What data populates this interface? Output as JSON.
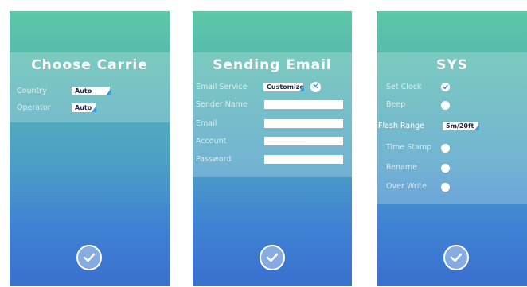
{
  "screen1": {
    "title": "Choose Carrie",
    "rows": [
      {
        "label": "Country",
        "value": "Auto"
      },
      {
        "label": "Operator",
        "value": "Auto"
      }
    ]
  },
  "screen2": {
    "title": "Sending Email",
    "email_service": {
      "label": "Email Service",
      "value": "Customize",
      "icon": "close-icon"
    },
    "fields": [
      {
        "label": "Sender Name",
        "value": ""
      },
      {
        "label": "Email",
        "value": ""
      },
      {
        "label": "Account",
        "value": ""
      },
      {
        "label": "Password",
        "value": ""
      }
    ]
  },
  "screen3": {
    "title": "SYS",
    "items": [
      {
        "label": "Set Clock",
        "state": "checked"
      },
      {
        "label": "Beep",
        "state": "unchecked"
      },
      {
        "label": "Flash Range",
        "value": "5m/20ft"
      },
      {
        "label": "Time Stamp",
        "state": "unchecked"
      },
      {
        "label": "Rename",
        "state": "unchecked"
      },
      {
        "label": "Over Write",
        "state": "unchecked"
      }
    ]
  },
  "colors": {
    "gradient_top": "#5cc8a6",
    "gradient_bottom": "#3a70cf",
    "accent": "#2f9fe0"
  },
  "icons": {
    "confirm": "check-circle-icon"
  }
}
